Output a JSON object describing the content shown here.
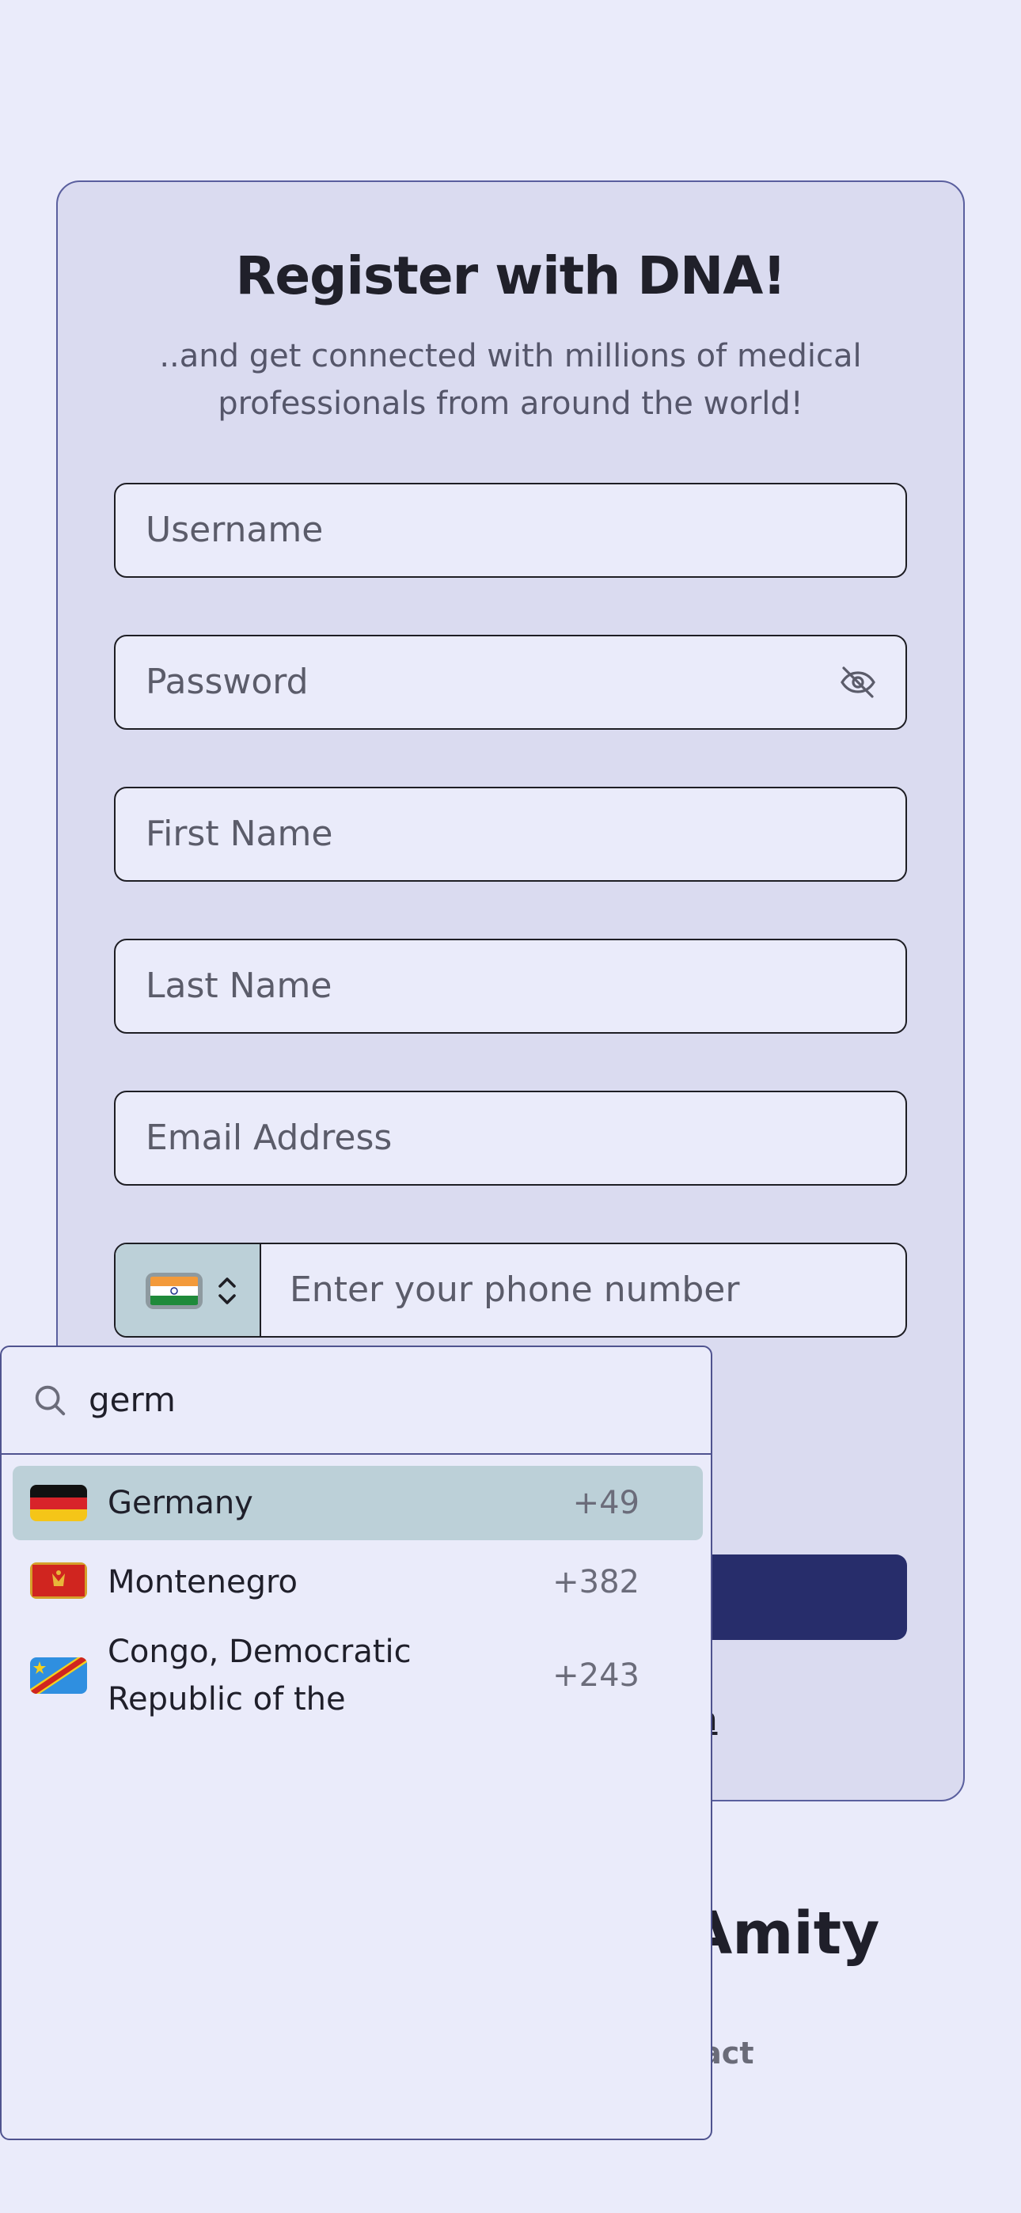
{
  "form": {
    "title": "Register with DNA!",
    "subtitle": "..and get connected with millions of medical professionals from around the world!",
    "username_placeholder": "Username",
    "password_placeholder": "Password",
    "first_name_placeholder": "First Name",
    "last_name_placeholder": "Last Name",
    "email_placeholder": "Email Address",
    "phone_placeholder": "Enter your phone number",
    "selected_country_flag": "india-flag-icon",
    "login_link_visible": "in"
  },
  "country_dropdown": {
    "search_value": "germ",
    "options": [
      {
        "name": "Germany",
        "code": "+49",
        "flag": "germany-flag-icon",
        "highlighted": true
      },
      {
        "name": "Montenegro",
        "code": "+382",
        "flag": "montenegro-flag-icon",
        "highlighted": false
      },
      {
        "name": "Congo, Democratic Republic of the",
        "code": "+243",
        "flag": "congo-dr-flag-icon",
        "highlighted": false
      }
    ]
  },
  "footer": {
    "brand_visible": "Amity",
    "contact_visible": "tact"
  },
  "colors": {
    "page_bg": "#eaebfa",
    "card_bg": "#dadbf0",
    "primary_button": "#272d6b",
    "highlight": "#bcd0d8",
    "border_accent": "#4f538f"
  }
}
